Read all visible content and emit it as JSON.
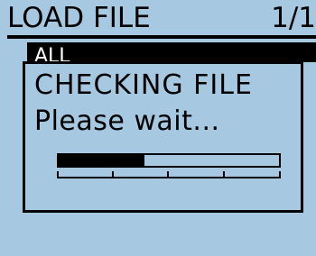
{
  "header": {
    "title": "LOAD FILE",
    "page_indicator": "1/1"
  },
  "list": {
    "selected_label": "ALL"
  },
  "dialog": {
    "title": "CHECKING FILE",
    "message": "Please wait...",
    "progress_fraction": 0.39
  }
}
